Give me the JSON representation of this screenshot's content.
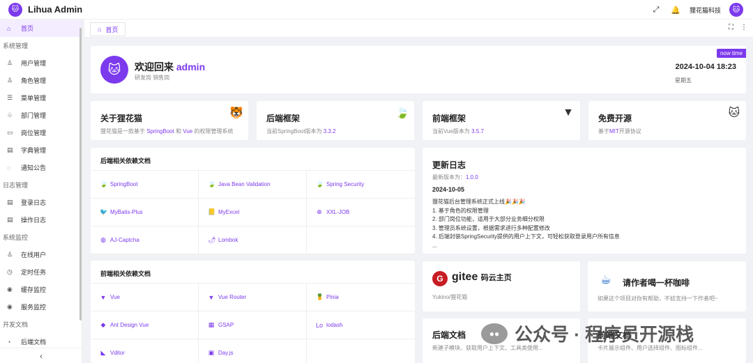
{
  "header": {
    "logo": "🐱",
    "title": "Lihua Admin",
    "user_name": "狸花猫科技",
    "user_avatar": "🐱"
  },
  "sidebar": {
    "items": [
      {
        "type": "item",
        "label": "首页",
        "icon": "home-icon",
        "glyph": "⌂",
        "active": true
      },
      {
        "type": "group",
        "label": "系统管理"
      },
      {
        "type": "item",
        "label": "用户管理",
        "icon": "user-icon",
        "glyph": "♙"
      },
      {
        "type": "item",
        "label": "角色管理",
        "icon": "role-icon",
        "glyph": "♙"
      },
      {
        "type": "item",
        "label": "菜单管理",
        "icon": "menu-icon",
        "glyph": "☰"
      },
      {
        "type": "item",
        "label": "部门管理",
        "icon": "dept-icon",
        "glyph": "♧"
      },
      {
        "type": "item",
        "label": "岗位管理",
        "icon": "post-icon",
        "glyph": "▭"
      },
      {
        "type": "item",
        "label": "字典管理",
        "icon": "dict-icon",
        "glyph": "▤"
      },
      {
        "type": "item",
        "label": "通知公告",
        "icon": "notice-icon",
        "glyph": "◌"
      },
      {
        "type": "group",
        "label": "日志管理"
      },
      {
        "type": "item",
        "label": "登录日志",
        "icon": "login-log-icon",
        "glyph": "▤"
      },
      {
        "type": "item",
        "label": "操作日志",
        "icon": "oper-log-icon",
        "glyph": "▤"
      },
      {
        "type": "group",
        "label": "系统监控"
      },
      {
        "type": "item",
        "label": "在线用户",
        "icon": "online-icon",
        "glyph": "♙"
      },
      {
        "type": "item",
        "label": "定时任务",
        "icon": "job-icon",
        "glyph": "◷"
      },
      {
        "type": "item",
        "label": "缓存监控",
        "icon": "cache-icon",
        "glyph": "◉"
      },
      {
        "type": "item",
        "label": "服务监控",
        "icon": "server-icon",
        "glyph": "◉"
      },
      {
        "type": "group",
        "label": "开发文档"
      },
      {
        "type": "item",
        "label": "后端文档",
        "icon": "backend-doc-icon",
        "glyph": "◔"
      }
    ],
    "collapse_glyph": "‹"
  },
  "tabs": {
    "home_label": "首页",
    "home_glyph": "⌂"
  },
  "welcome": {
    "avatar": "🐱",
    "greeting": "欢迎回来",
    "username": "admin",
    "roles": "研发岗  销售岗",
    "badge": "now time",
    "datetime": "2024-10-04 18:23",
    "weekday": "星期五"
  },
  "cards": [
    {
      "title": "关于狸花猫",
      "desc_prefix": "狸花猫是一款基于 ",
      "desc_hl1": "SpringBoot",
      "desc_mid": " 和 ",
      "desc_hl2": "Vue",
      "desc_suffix": " 的权限管理系统",
      "icon": "cat-icon",
      "glyph": "🐯"
    },
    {
      "title": "后端框架",
      "desc_prefix": "当前SpringBoot版本为 ",
      "desc_hl1": "3.3.2",
      "icon": "spring-icon",
      "glyph": "🍃"
    },
    {
      "title": "前端框架",
      "desc_prefix": "当前Vue版本为 ",
      "desc_hl1": "3.5.7",
      "icon": "vue-icon",
      "glyph": "▼"
    },
    {
      "title": "免费开源",
      "desc_prefix": "基于",
      "desc_hl1": "MIT",
      "desc_suffix": "开源协议",
      "icon": "github-cat-icon",
      "glyph": "🐱"
    }
  ],
  "backend_deps": {
    "title": "后端相关依赖文档",
    "items": [
      {
        "label": "SpringBoot",
        "glyph": "🍃"
      },
      {
        "label": "Java Bean Validation",
        "glyph": "🍃"
      },
      {
        "label": "Spring Security",
        "glyph": "🍃"
      },
      {
        "label": "MyBatis-Plus",
        "glyph": "🐦"
      },
      {
        "label": "MyExcel",
        "glyph": "📒"
      },
      {
        "label": "XXL-JOB",
        "glyph": "⊕"
      },
      {
        "label": "AJ-Captcha",
        "glyph": "◍"
      },
      {
        "label": "Lombok",
        "glyph": "🌶"
      }
    ]
  },
  "frontend_deps": {
    "title": "前端相关依赖文档",
    "items": [
      {
        "label": "Vue",
        "glyph": "▼"
      },
      {
        "label": "Vue Router",
        "glyph": "▼"
      },
      {
        "label": "Pinia",
        "glyph": "🍍"
      },
      {
        "label": "Ant Design Vue",
        "glyph": "◆"
      },
      {
        "label": "GSAP",
        "glyph": "▦"
      },
      {
        "label": "lodash",
        "glyph": "Lo"
      },
      {
        "label": "Vditor",
        "glyph": "◣"
      },
      {
        "label": "Day.js",
        "glyph": "▣"
      }
    ]
  },
  "changelog": {
    "title": "更新日志",
    "version_label": "最新版本为：",
    "version": "1.0.0",
    "date": "2024-10-05",
    "lines": [
      "狸花猫后台管理系统正式上线🎉🎉🎉",
      "1. 基于角色的权限管理",
      "2. 部门岗位功能，适用于大部分业务细分权限",
      "3. 管理员系统设置，根据需求进行多种配置修改",
      "4. 后端封装SpringSecurity提供的用户上下文，可轻松获取登录用户所有信息",
      "..."
    ]
  },
  "gitee": {
    "logo": "G",
    "name": "gitee",
    "sub": "码云主页",
    "owner": "Yukino/狸花猫"
  },
  "coffee": {
    "glyph": "☕",
    "title": "请作者喝一杯咖啡",
    "desc": "如果这个项目对你有帮助，不妨支持一下作者吧~"
  },
  "bottom_cards": [
    {
      "title": "后端文档",
      "desc": "新建子模块、获取用户上下文、工具类使用..."
    },
    {
      "title": "前端文档",
      "desc": "卡片展示组件、用户选择组件、图标组件..."
    }
  ],
  "watermark": {
    "glyph": "●●",
    "text": "公众号 · 程序员开源栈"
  }
}
